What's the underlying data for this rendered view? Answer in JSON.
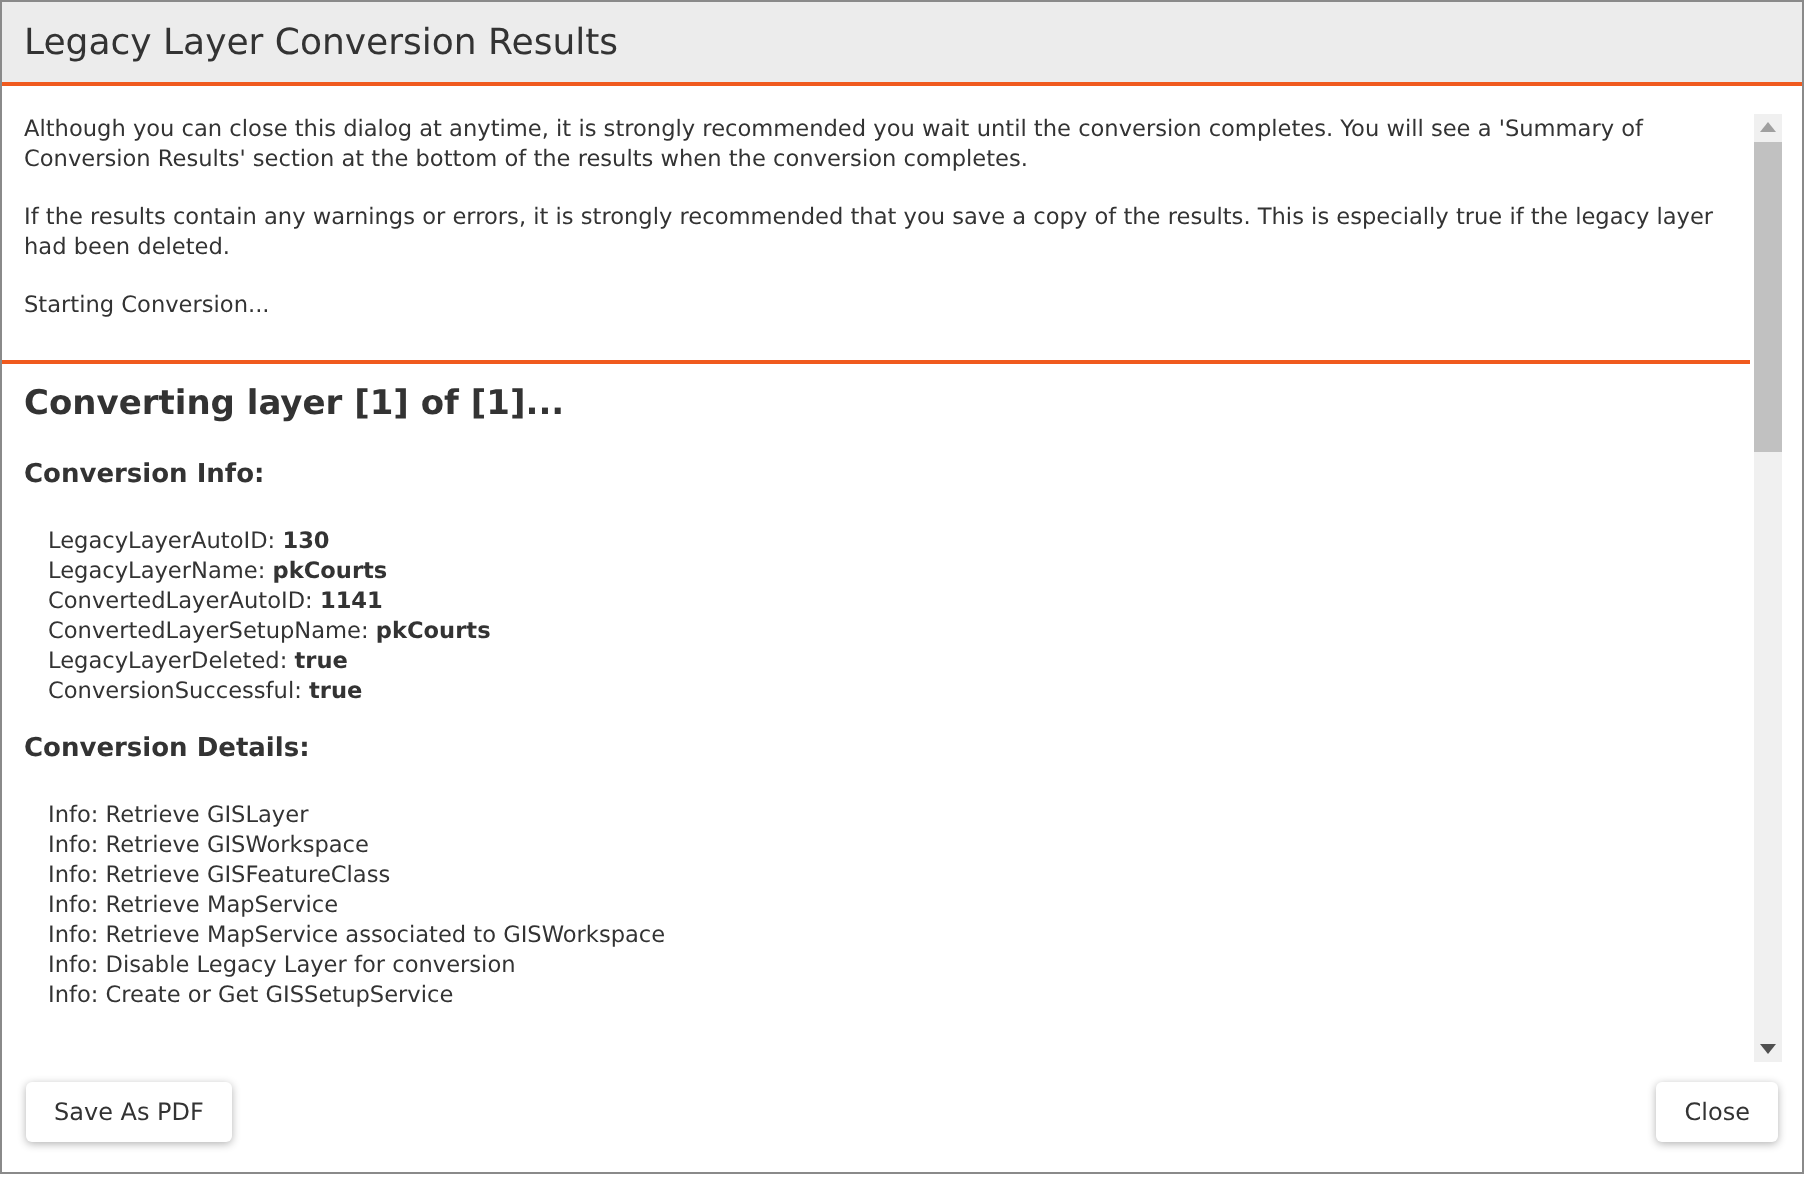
{
  "window": {
    "title": "Legacy Layer Conversion Results"
  },
  "intro": [
    "Although you can close this dialog at anytime, it is strongly recommended you wait until the conversion completes. You will see a 'Summary of Conversion Results' section at the bottom of the results when the conversion completes.",
    "If the results contain any warnings or errors, it is strongly recommended that you save a copy of the results. This is especially true if the legacy layer had been deleted.",
    "Starting Conversion..."
  ],
  "layer_heading": "Converting layer [1] of [1]...",
  "conversion_info": {
    "heading": "Conversion Info:",
    "items": [
      {
        "label": "LegacyLayerAutoID:",
        "value": "130"
      },
      {
        "label": "LegacyLayerName:",
        "value": "pkCourts"
      },
      {
        "label": "ConvertedLayerAutoID:",
        "value": "1141"
      },
      {
        "label": "ConvertedLayerSetupName:",
        "value": "pkCourts"
      },
      {
        "label": "LegacyLayerDeleted:",
        "value": "true"
      },
      {
        "label": "ConversionSuccessful:",
        "value": "true"
      }
    ]
  },
  "conversion_details": {
    "heading": "Conversion Details:",
    "lines": [
      "Info: Retrieve GISLayer",
      "Info: Retrieve GISWorkspace",
      "Info: Retrieve GISFeatureClass",
      "Info: Retrieve MapService",
      "Info: Retrieve MapService associated to GISWorkspace",
      "Info: Disable Legacy Layer for conversion",
      "Info: Create or Get GISSetupService"
    ]
  },
  "buttons": [
    "Save As PDF",
    "Close"
  ]
}
